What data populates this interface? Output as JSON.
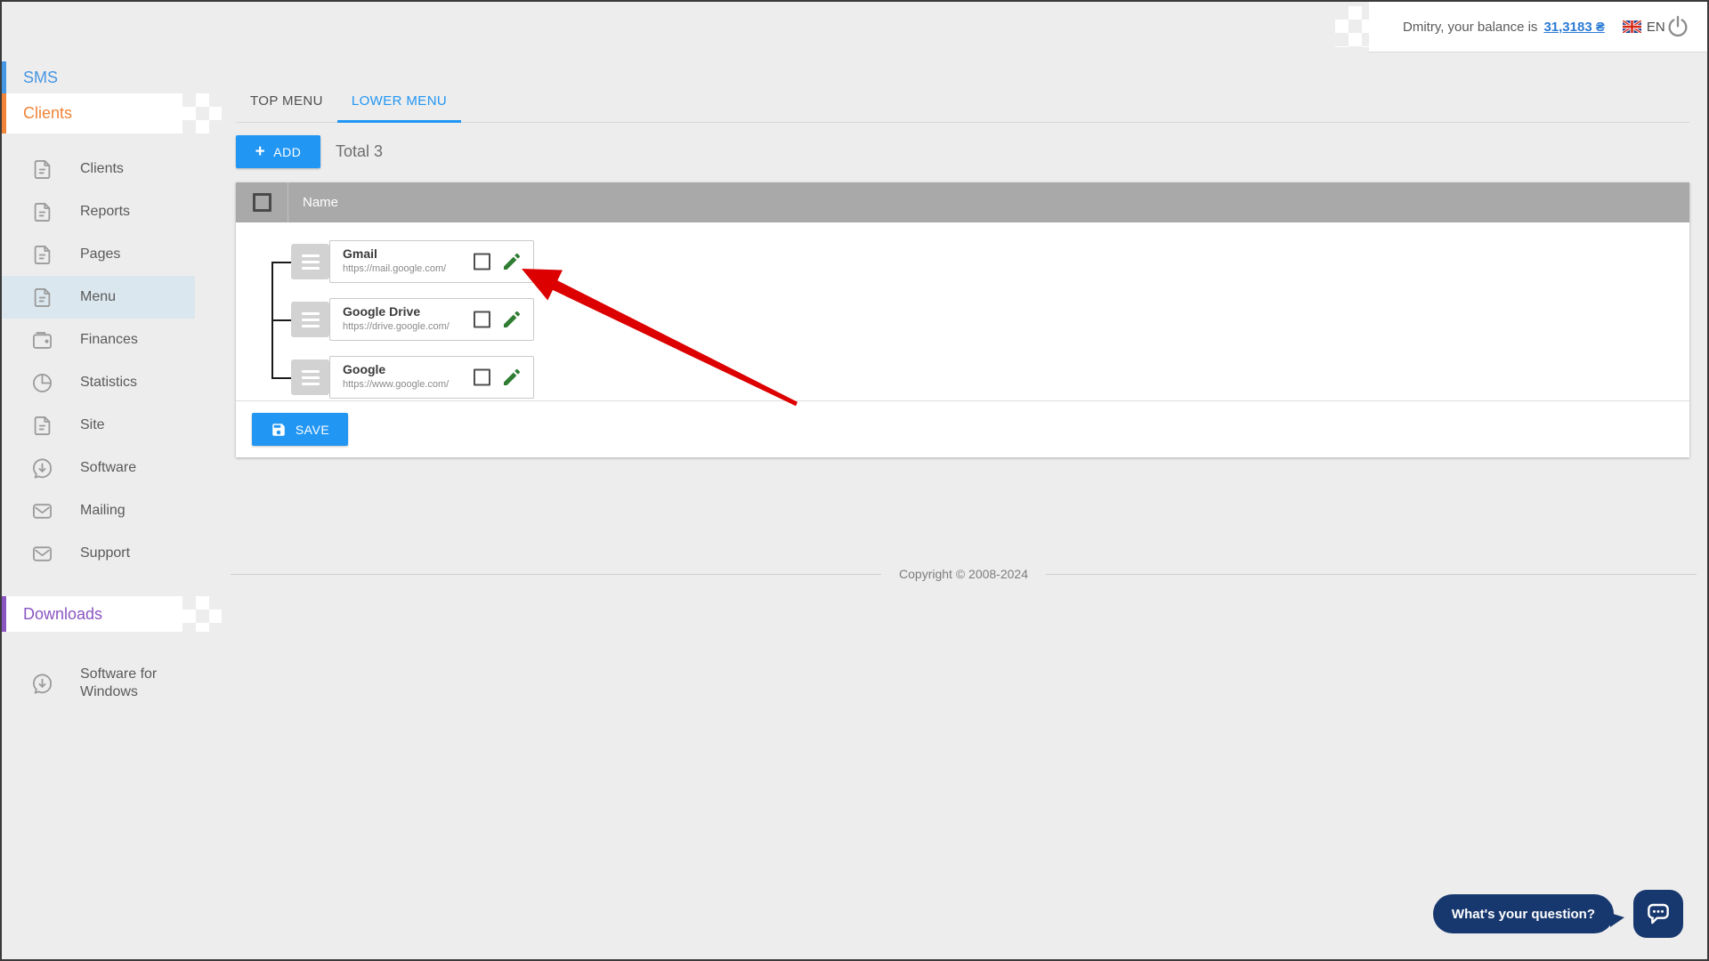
{
  "topbar": {
    "greeting": "Dmitry, your balance is",
    "balance": "31,3183 ₴",
    "language": "EN"
  },
  "sidebar": {
    "sections": [
      {
        "label": "SMS"
      },
      {
        "label": "Clients"
      }
    ],
    "items": [
      {
        "label": "Clients",
        "icon": "document"
      },
      {
        "label": "Reports",
        "icon": "document"
      },
      {
        "label": "Pages",
        "icon": "document"
      },
      {
        "label": "Menu",
        "icon": "document",
        "active": true
      },
      {
        "label": "Finances",
        "icon": "wallet"
      },
      {
        "label": "Statistics",
        "icon": "pie-chart"
      },
      {
        "label": "Site",
        "icon": "document"
      },
      {
        "label": "Software",
        "icon": "download"
      },
      {
        "label": "Mailing",
        "icon": "envelope"
      },
      {
        "label": "Support",
        "icon": "envelope"
      }
    ],
    "downloads_section": {
      "label": "Downloads"
    },
    "downloads_items": [
      {
        "label": "Software for Windows",
        "icon": "download"
      }
    ]
  },
  "tabs": [
    {
      "label": "TOP MENU",
      "active": false
    },
    {
      "label": "LOWER MENU",
      "active": true
    }
  ],
  "toolbar": {
    "add_icon": "+",
    "add_label": "ADD",
    "total": "Total 3"
  },
  "table": {
    "header": {
      "name_column": "Name"
    },
    "rows": [
      {
        "title": "Gmail",
        "url": "https://mail.google.com/"
      },
      {
        "title": "Google Drive",
        "url": "https://drive.google.com/"
      },
      {
        "title": "Google",
        "url": "https://www.google.com/"
      }
    ]
  },
  "actions": {
    "save_label": "SAVE"
  },
  "footer": {
    "copyright": "Copyright © 2008-2024"
  },
  "chat": {
    "prompt": "What's your question?"
  },
  "colors": {
    "accent": "#2196f3",
    "sms_blue": "#4796e3",
    "clients_orange": "#f08438",
    "downloads_purple": "#8a56c2",
    "edit_green": "#2e7d32",
    "arrow_red": "#dc0000",
    "chat_navy": "#17386e",
    "balance_link": "#2b7bd4",
    "table_header_gray": "#a9a9a9"
  }
}
